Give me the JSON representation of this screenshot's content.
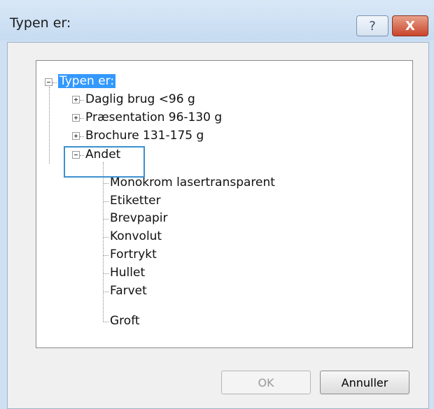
{
  "window": {
    "title": "Typen er:",
    "help_label": "?",
    "close_label": "X"
  },
  "tree": {
    "root": {
      "label": "Typen er:",
      "expanded": true,
      "selected": true
    },
    "children": [
      {
        "label": "Daglig brug <96 g",
        "expanded": false
      },
      {
        "label": "Præsentation 96-130 g",
        "expanded": false
      },
      {
        "label": "Brochure 131-175 g",
        "expanded": false
      },
      {
        "label": "Andet",
        "expanded": true,
        "children": [
          "Monokrom lasertransparent",
          "Etiketter",
          "Brevpapir",
          "Konvolut",
          "Fortrykt",
          "Hullet",
          "Farvet",
          "Groft"
        ]
      }
    ]
  },
  "buttons": {
    "ok_label": "OK",
    "cancel_label": "Annuller"
  },
  "colors": {
    "selection": "#3399ff",
    "highlight_border": "#3b8fd0"
  }
}
